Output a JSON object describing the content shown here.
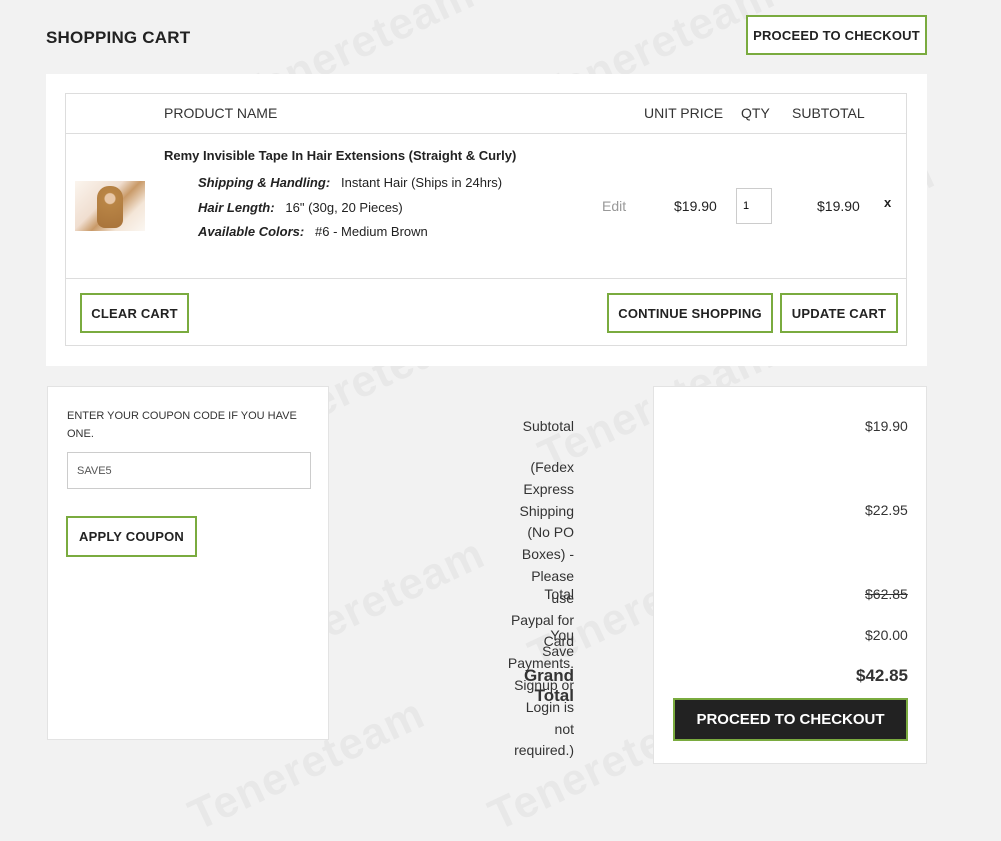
{
  "page": {
    "title": "SHOPPING CART",
    "watermark": "Tenereteam"
  },
  "top_checkout_label": "PROCEED TO CHECKOUT",
  "table": {
    "headers": {
      "product": "PRODUCT NAME",
      "unit_price": "UNIT PRICE",
      "qty": "QTY",
      "subtotal": "SUBTOTAL"
    },
    "item": {
      "name": "Remy Invisible Tape In Hair Extensions (Straight & Curly)",
      "options": [
        {
          "key": "Shipping & Handling:",
          "value": "Instant Hair (Ships in 24hrs)"
        },
        {
          "key": "Hair Length:",
          "value": "16\" (30g, 20 Pieces)"
        },
        {
          "key": "Available Colors:",
          "value": "#6 - Medium Brown"
        }
      ],
      "edit": "Edit",
      "unit_price": "$19.90",
      "qty": "1",
      "subtotal": "$19.90",
      "remove": "x"
    }
  },
  "actions": {
    "clear": "CLEAR CART",
    "continue": "CONTINUE SHOPPING",
    "update": "UPDATE CART"
  },
  "coupon": {
    "label": "ENTER YOUR COUPON CODE IF YOU HAVE ONE.",
    "value": "SAVE5",
    "apply": "APPLY COUPON"
  },
  "totals": {
    "subtotal_label": "Subtotal",
    "subtotal": "$19.90",
    "shipping_lines": [
      "(Fedex Express Shipping",
      "(No PO Boxes) - Please",
      "use Paypal for Card",
      "Payments. Signup or",
      "Login is not required.)"
    ],
    "shipping": "$22.95",
    "total_label": "Total",
    "total": "$62.85",
    "save_label": "You Save",
    "save": "$20.00",
    "grand_label": "Grand Total",
    "grand": "$42.85",
    "checkout": "PROCEED TO CHECKOUT"
  },
  "colors": {
    "accent": "#7aab3f",
    "dark": "#222222",
    "background": "#f2f2f2"
  }
}
